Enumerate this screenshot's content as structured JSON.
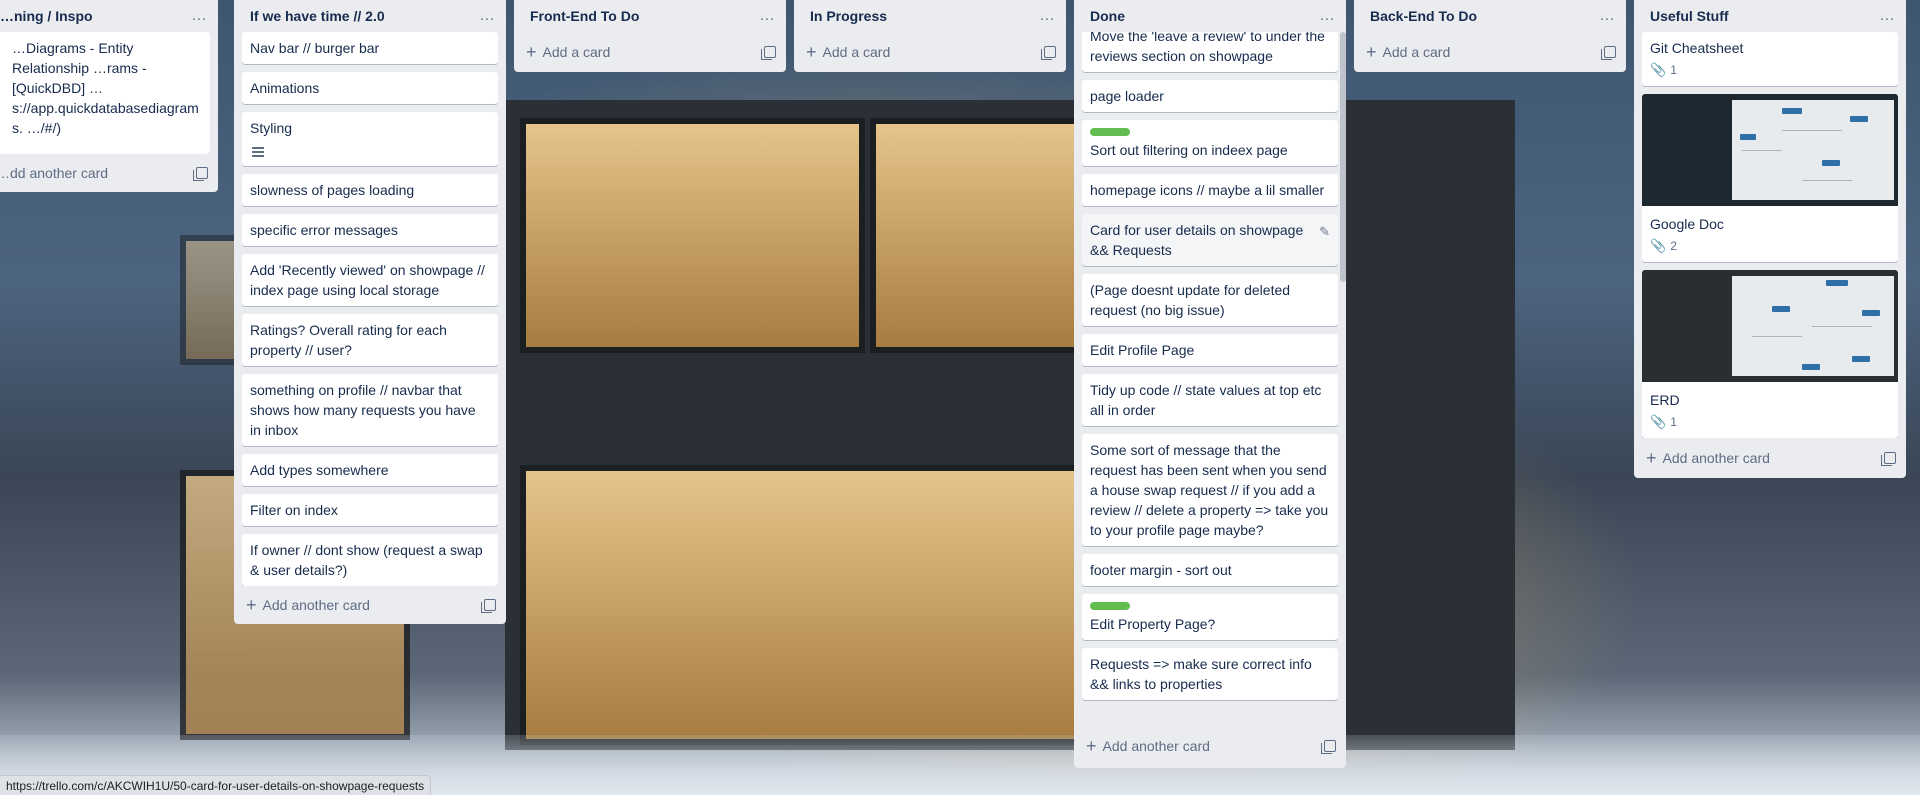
{
  "lists": [
    {
      "title": "…ning / Inspo",
      "cards": [
        {
          "text": "…Diagrams - Entity Relationship …rams - [QuickDBD] …s://app.quickdatabasediagrams. …/#/)"
        }
      ],
      "add_label": "…dd another card"
    },
    {
      "title": "If we have time // 2.0",
      "cards": [
        {
          "text": "Nav bar // burger bar"
        },
        {
          "text": "Animations"
        },
        {
          "text": "Styling",
          "has_description": true
        },
        {
          "text": "slowness of pages loading"
        },
        {
          "text": "specific error messages"
        },
        {
          "text": "Add 'Recently viewed' on showpage // index page using local storage"
        },
        {
          "text": "Ratings? Overall rating for each property // user?"
        },
        {
          "text": "something on profile // navbar that shows how many requests you have in inbox"
        },
        {
          "text": "Add types somewhere"
        },
        {
          "text": "Filter on index"
        },
        {
          "text": "If owner // dont show (request a swap & user details?)"
        }
      ],
      "add_label": "Add another card"
    },
    {
      "title": "Front-End To Do",
      "cards": [],
      "add_label": "Add a card"
    },
    {
      "title": "In Progress",
      "cards": [],
      "add_label": "Add a card"
    },
    {
      "title": "Done",
      "cards": [
        {
          "text": "Move the 'leave a review' to under the reviews section on showpage"
        },
        {
          "text": "page loader"
        },
        {
          "text": "Sort out filtering on indeex page",
          "label": "green"
        },
        {
          "text": "homepage icons // maybe a lil smaller"
        },
        {
          "text": "Card for user details on showpage && Requests",
          "hovered": true
        },
        {
          "text": "(Page doesnt update for deleted request (no big issue)"
        },
        {
          "text": "Edit Profile Page"
        },
        {
          "text": "Tidy up code // state values at top etc all in order"
        },
        {
          "text": "Some sort of message that the request has been sent when you send a house swap request // if you add a review // delete a property => take you to your profile page maybe?"
        },
        {
          "text": "footer margin - sort out"
        },
        {
          "text": "Edit Property Page?",
          "label": "green"
        },
        {
          "text": "Requests => make sure correct info && links to properties"
        }
      ],
      "add_label": "Add another card"
    },
    {
      "title": "Back-End To Do",
      "cards": [],
      "add_label": "Add a card"
    },
    {
      "title": "Useful Stuff",
      "cards": [
        {
          "text": "Git Cheatsheet",
          "attachments": "1"
        },
        {
          "text": "Google Doc",
          "attachments": "2",
          "cover": true
        },
        {
          "text": "ERD",
          "attachments": "1",
          "cover": true
        }
      ],
      "add_label": "Add another card"
    }
  ],
  "icons": {
    "menu": "…",
    "plus": "+",
    "attachment": "📎",
    "edit": "✎"
  },
  "status_url": "https://trello.com/c/AKCWIH1U/50-card-for-user-details-on-showpage-requests"
}
